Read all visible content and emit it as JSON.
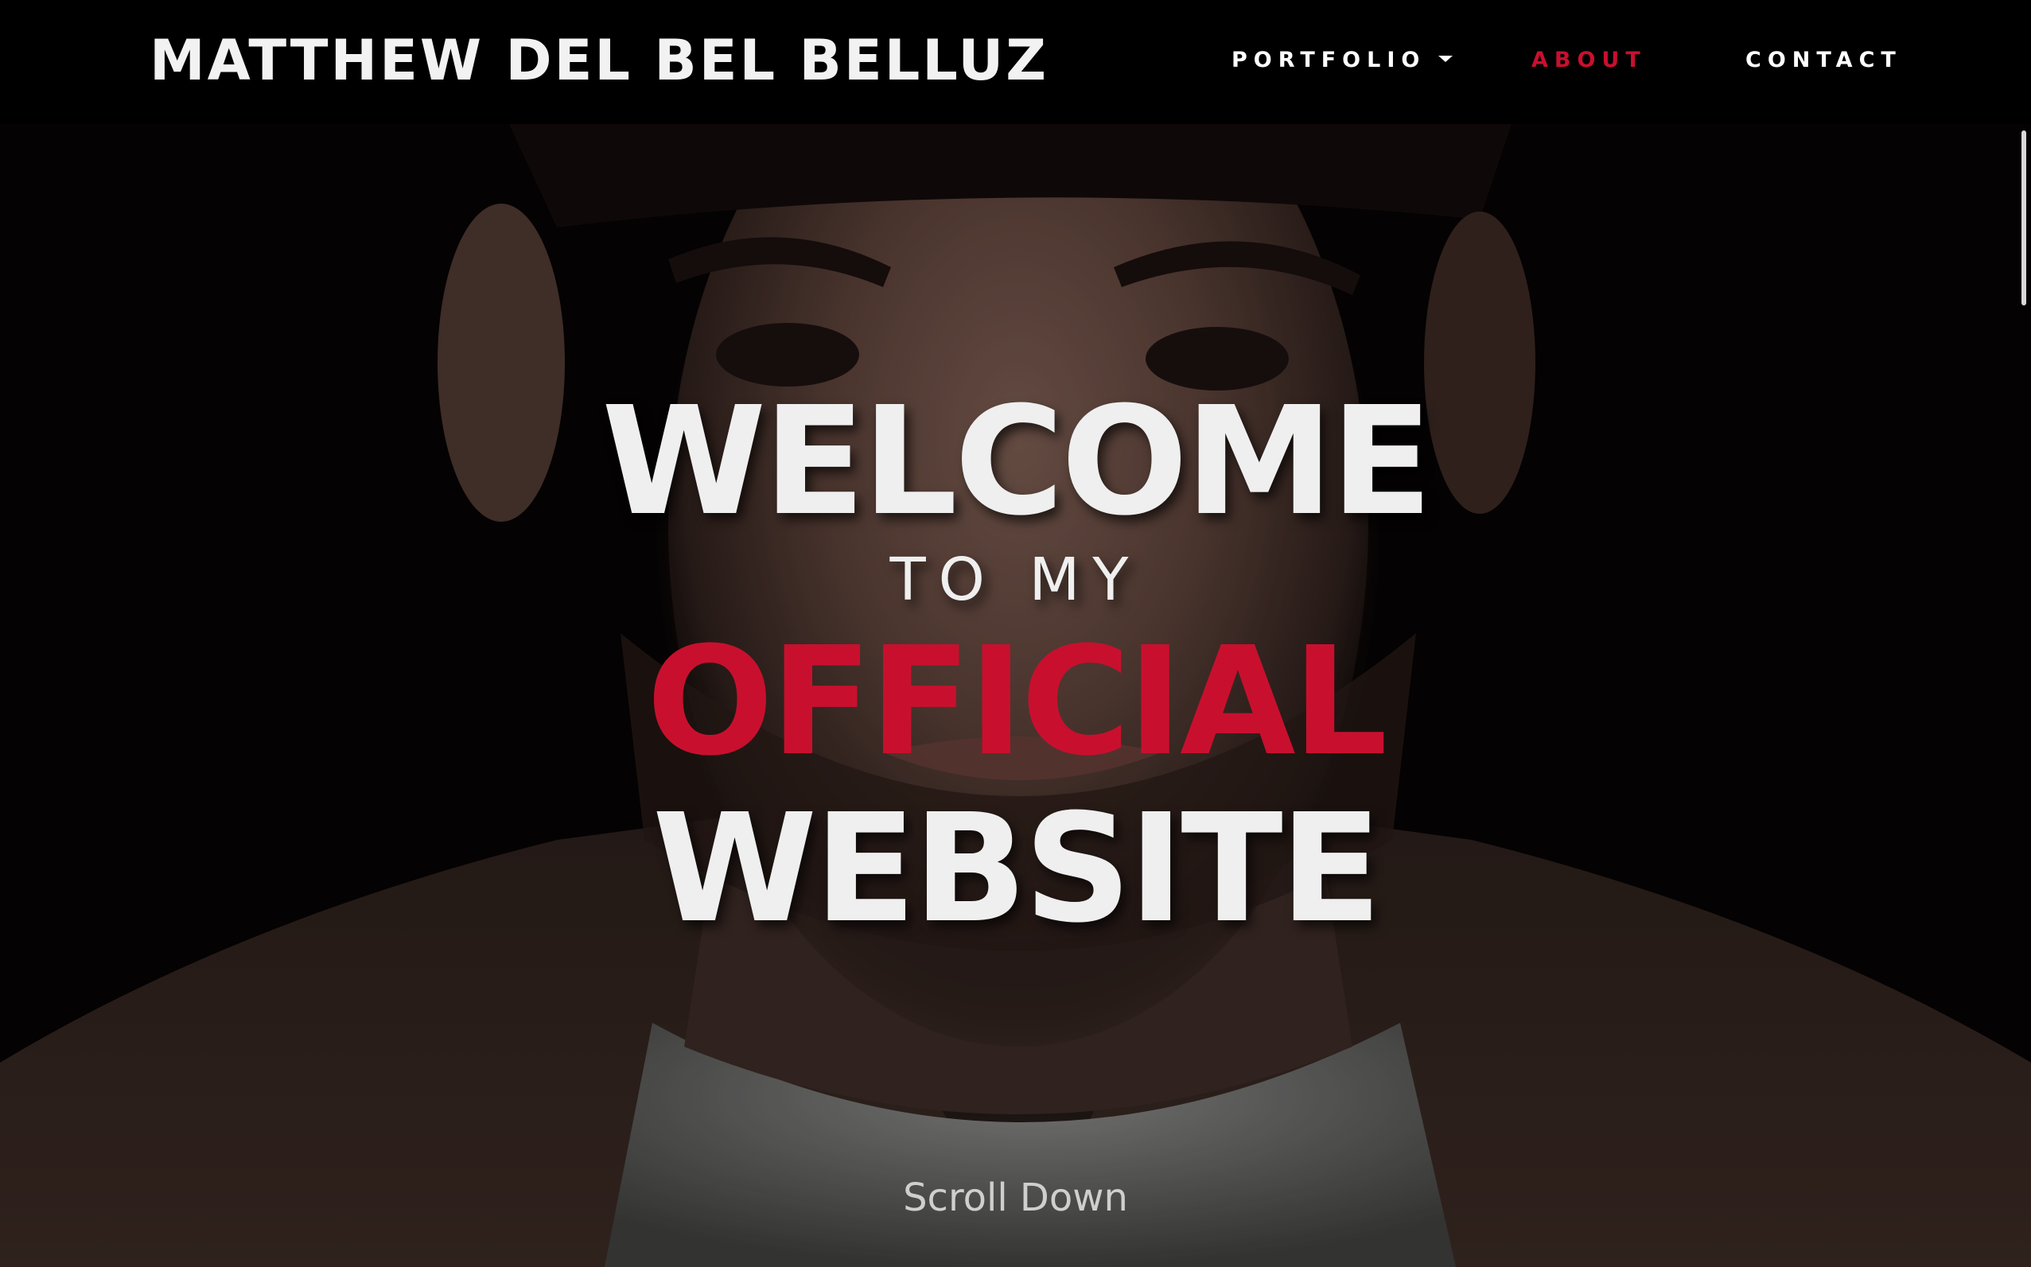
{
  "navbar": {
    "brand": "MATTHEW DEL BEL BELLUZ",
    "items": [
      {
        "label": "PORTFOLIO",
        "has_dropdown": true,
        "active": false
      },
      {
        "label": "ABOUT",
        "has_dropdown": false,
        "active": true
      },
      {
        "label": "CONTACT",
        "has_dropdown": false,
        "active": false
      }
    ]
  },
  "hero": {
    "line1": "WELCOME",
    "line2": "TO MY",
    "line3": "OFFICIAL",
    "line4": "WEBSITE",
    "scroll_label": "Scroll Down"
  },
  "icons": {
    "dropdown": "chevron-down-icon"
  },
  "colors": {
    "accent": "#c8102e",
    "background": "#000000",
    "text": "#efefef"
  }
}
